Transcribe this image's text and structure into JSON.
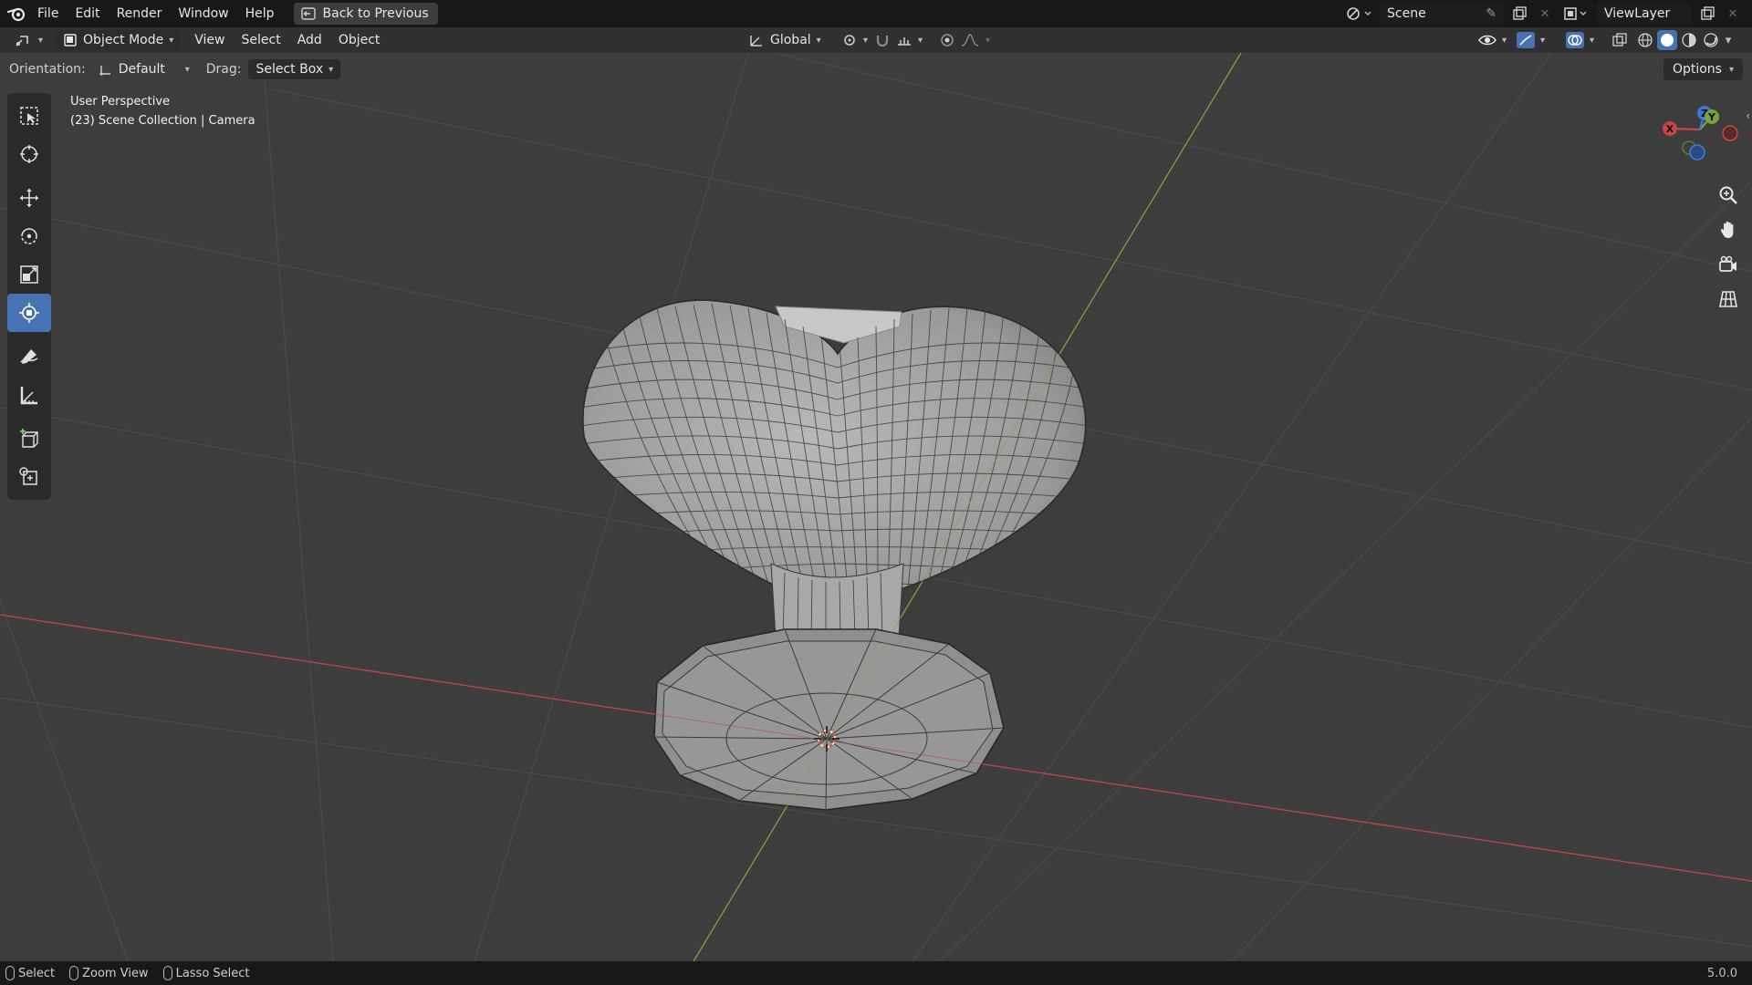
{
  "menu": {
    "items": [
      "File",
      "Edit",
      "Render",
      "Window",
      "Help"
    ],
    "back_button": "Back to Previous"
  },
  "topbar_right": {
    "scene": "Scene",
    "view_layer": "ViewLayer"
  },
  "header": {
    "mode": "Object Mode",
    "menus": [
      "View",
      "Select",
      "Add",
      "Object"
    ],
    "transform_orientation": "Global"
  },
  "tool_settings": {
    "orientation_label": "Orientation:",
    "orientation_value": "Default",
    "drag_label": "Drag:",
    "drag_value": "Select Box",
    "options_label": "Options"
  },
  "viewport": {
    "view_name": "User Perspective",
    "collection_info": "(23) Scene Collection | Camera",
    "gizmo": {
      "x_label": "X",
      "y_label": "Y",
      "z_label": "Z"
    }
  },
  "toolbar": {
    "tools": [
      "select-box",
      "cursor",
      "move",
      "rotate",
      "scale",
      "transform",
      "annotate",
      "measure",
      "add-cube",
      "add-object"
    ],
    "active_tool": "transform"
  },
  "statusbar": {
    "items": [
      "Select",
      "Zoom View",
      "Lasso Select"
    ],
    "version": "5.0.0"
  },
  "colors": {
    "accent": "#4772b3",
    "x_axis": "#c84646",
    "y_axis": "#7ba23a",
    "z_axis": "#3e78d8",
    "viewport_bg": "#3d3d3d"
  }
}
